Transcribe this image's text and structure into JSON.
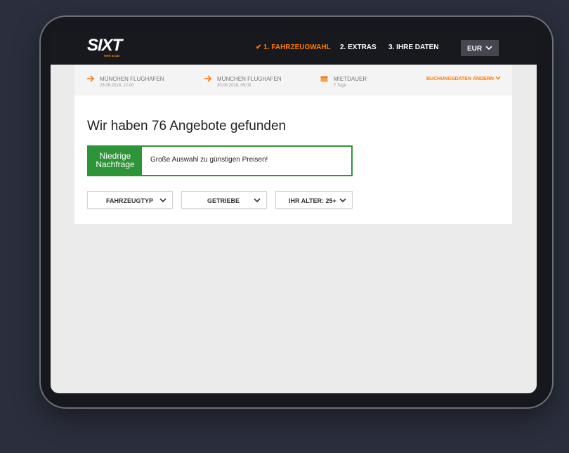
{
  "brand": {
    "logo_text": "SIXT",
    "logo_sub": "rent a car"
  },
  "header": {
    "steps": [
      {
        "check": "✔",
        "label": "1. FAHRZEUGWAHL",
        "active": true
      },
      {
        "label": "2. EXTRAS",
        "active": false
      },
      {
        "label": "3. IHRE DATEN",
        "active": false
      }
    ],
    "currency": "EUR"
  },
  "booking": {
    "pickup": {
      "location": "MÜNCHEN FLUGHAFEN",
      "datetime": "23.06.2018, 12:00"
    },
    "return": {
      "location": "MÜNCHEN FLUGHAFEN",
      "datetime": "30.06.2018, 09:00"
    },
    "duration": {
      "label": "MIETDAUER",
      "value": "7 Tage"
    },
    "change_label": "BUCHUNGSDATEN ÄNDERN"
  },
  "results": {
    "headline": "Wir haben 76 Angebote gefunden",
    "demand_badge_line1": "Niedrige",
    "demand_badge_line2": "Nachfrage",
    "demand_message": "Große Auswahl zu günstigen Preisen!"
  },
  "filters": [
    {
      "label": "FAHRZEUGTYP"
    },
    {
      "label": "GETRIEBE"
    },
    {
      "label": "IHR ALTER: 25+"
    }
  ],
  "colors": {
    "accent": "#ff7a00",
    "demand_green": "#2e9438",
    "topbar": "#18191e"
  },
  "icons": {
    "arrow": "arrow-right-icon",
    "calendar": "calendar-icon",
    "chevron": "chevron-down-icon"
  }
}
